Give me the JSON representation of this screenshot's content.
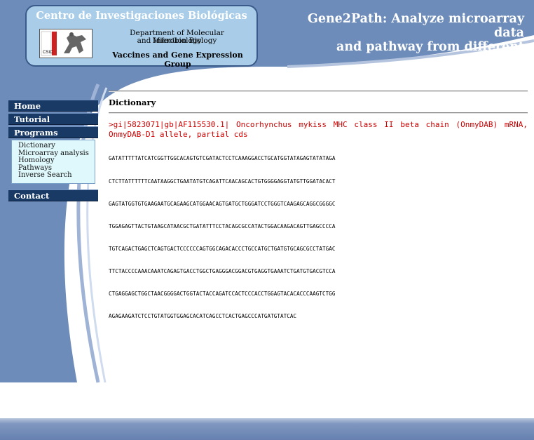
{
  "header": {
    "institute": "Centro de Investigaciones Biológicas",
    "department_line1": "Department of Molecular Microbiology",
    "department_line2": "and Infection Biology",
    "group": "Vaccines and Gene Expression Group",
    "headline_line1": "Gene2Path: Analyze microarray data",
    "headline_line2": "and pathway from different species",
    "logo_text": "CSIC"
  },
  "nav": {
    "home": "Home",
    "tutorial": "Tutorial",
    "programs": "Programs",
    "contact": "Contact",
    "programs_items": [
      "Dictionary",
      "Microarray analysis",
      "Homology",
      "Pathways",
      "Inverse Search"
    ]
  },
  "content": {
    "title": "Dictionary",
    "fasta_header": ">gi|5823071|gb|AF115530.1| Oncorhynchus mykiss MHC class II beta chain (OnmyDAB) mRNA, OnmyDAB-D1 allele, partial cds",
    "sequence_lines": [
      "GATATTTTTATCATCGGTTGGCACAGTGTCGATACTCCTCAAAGGACCTGCATGGTATAGAGTATATAGA",
      "CTCTTATTTTTTCAATAAGGCTGAATATGTCAGATTCAACAGCACTGTGGGGAGGTATGTTGGATACACT",
      "GAGTATGGTGTGAAGAATGCAGAAGCATGGAACAGTGATGCTGGGATCCTGGGTCAAGAGCAGGCGGGGC",
      "TGGAGAGTTACTGTAAGCATAACGCTGATATTTCCTACAGCGCCATACTGGACAAGACAGTTGAGCCCCA",
      "TGTCAGACTGAGCTCAGTGACTCCCCCCAGTGGCAGACACCCTGCCATGCTGATGTGCAGCGCCTATGAC",
      "TTCTACCCCAAACAAATCAGAGTGACCTGGCTGAGGGACGGACGTGAGGTGAAATCTGATGTGACGTCCA",
      "CTGAGGAGCTGGCTAACGGGGACTGGTACTACCAGATCCACTCCCACCTGGAGTACACACCCAAGTCTGG",
      "AGAGAAGATCTCCTGTATGGTGGAGCACATCAGCCTCACTGAGCCCATGATGTATCAC"
    ]
  },
  "colors": {
    "page_blue": "#6e8cb9",
    "nav_dark": "#1a3a66",
    "logo_box": "#a9cde8",
    "fasta_red": "#cc0000"
  }
}
